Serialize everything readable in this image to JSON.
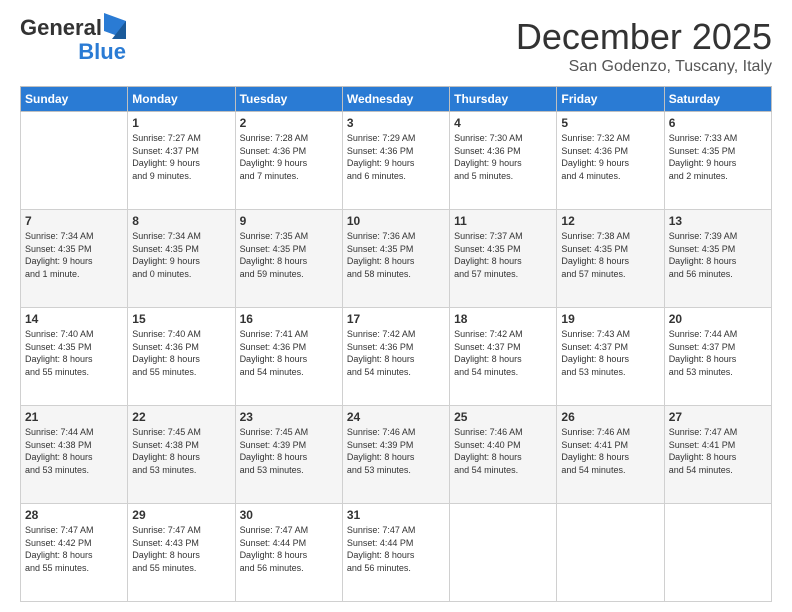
{
  "logo": {
    "general": "General",
    "blue": "Blue"
  },
  "header": {
    "month_title": "December 2025",
    "location": "San Godenzo, Tuscany, Italy"
  },
  "days_of_week": [
    "Sunday",
    "Monday",
    "Tuesday",
    "Wednesday",
    "Thursday",
    "Friday",
    "Saturday"
  ],
  "weeks": [
    [
      {
        "day": "",
        "info": ""
      },
      {
        "day": "1",
        "info": "Sunrise: 7:27 AM\nSunset: 4:37 PM\nDaylight: 9 hours\nand 9 minutes."
      },
      {
        "day": "2",
        "info": "Sunrise: 7:28 AM\nSunset: 4:36 PM\nDaylight: 9 hours\nand 7 minutes."
      },
      {
        "day": "3",
        "info": "Sunrise: 7:29 AM\nSunset: 4:36 PM\nDaylight: 9 hours\nand 6 minutes."
      },
      {
        "day": "4",
        "info": "Sunrise: 7:30 AM\nSunset: 4:36 PM\nDaylight: 9 hours\nand 5 minutes."
      },
      {
        "day": "5",
        "info": "Sunrise: 7:32 AM\nSunset: 4:36 PM\nDaylight: 9 hours\nand 4 minutes."
      },
      {
        "day": "6",
        "info": "Sunrise: 7:33 AM\nSunset: 4:35 PM\nDaylight: 9 hours\nand 2 minutes."
      }
    ],
    [
      {
        "day": "7",
        "info": "Sunrise: 7:34 AM\nSunset: 4:35 PM\nDaylight: 9 hours\nand 1 minute."
      },
      {
        "day": "8",
        "info": "Sunrise: 7:34 AM\nSunset: 4:35 PM\nDaylight: 9 hours\nand 0 minutes."
      },
      {
        "day": "9",
        "info": "Sunrise: 7:35 AM\nSunset: 4:35 PM\nDaylight: 8 hours\nand 59 minutes."
      },
      {
        "day": "10",
        "info": "Sunrise: 7:36 AM\nSunset: 4:35 PM\nDaylight: 8 hours\nand 58 minutes."
      },
      {
        "day": "11",
        "info": "Sunrise: 7:37 AM\nSunset: 4:35 PM\nDaylight: 8 hours\nand 57 minutes."
      },
      {
        "day": "12",
        "info": "Sunrise: 7:38 AM\nSunset: 4:35 PM\nDaylight: 8 hours\nand 57 minutes."
      },
      {
        "day": "13",
        "info": "Sunrise: 7:39 AM\nSunset: 4:35 PM\nDaylight: 8 hours\nand 56 minutes."
      }
    ],
    [
      {
        "day": "14",
        "info": "Sunrise: 7:40 AM\nSunset: 4:35 PM\nDaylight: 8 hours\nand 55 minutes."
      },
      {
        "day": "15",
        "info": "Sunrise: 7:40 AM\nSunset: 4:36 PM\nDaylight: 8 hours\nand 55 minutes."
      },
      {
        "day": "16",
        "info": "Sunrise: 7:41 AM\nSunset: 4:36 PM\nDaylight: 8 hours\nand 54 minutes."
      },
      {
        "day": "17",
        "info": "Sunrise: 7:42 AM\nSunset: 4:36 PM\nDaylight: 8 hours\nand 54 minutes."
      },
      {
        "day": "18",
        "info": "Sunrise: 7:42 AM\nSunset: 4:37 PM\nDaylight: 8 hours\nand 54 minutes."
      },
      {
        "day": "19",
        "info": "Sunrise: 7:43 AM\nSunset: 4:37 PM\nDaylight: 8 hours\nand 53 minutes."
      },
      {
        "day": "20",
        "info": "Sunrise: 7:44 AM\nSunset: 4:37 PM\nDaylight: 8 hours\nand 53 minutes."
      }
    ],
    [
      {
        "day": "21",
        "info": "Sunrise: 7:44 AM\nSunset: 4:38 PM\nDaylight: 8 hours\nand 53 minutes."
      },
      {
        "day": "22",
        "info": "Sunrise: 7:45 AM\nSunset: 4:38 PM\nDaylight: 8 hours\nand 53 minutes."
      },
      {
        "day": "23",
        "info": "Sunrise: 7:45 AM\nSunset: 4:39 PM\nDaylight: 8 hours\nand 53 minutes."
      },
      {
        "day": "24",
        "info": "Sunrise: 7:46 AM\nSunset: 4:39 PM\nDaylight: 8 hours\nand 53 minutes."
      },
      {
        "day": "25",
        "info": "Sunrise: 7:46 AM\nSunset: 4:40 PM\nDaylight: 8 hours\nand 54 minutes."
      },
      {
        "day": "26",
        "info": "Sunrise: 7:46 AM\nSunset: 4:41 PM\nDaylight: 8 hours\nand 54 minutes."
      },
      {
        "day": "27",
        "info": "Sunrise: 7:47 AM\nSunset: 4:41 PM\nDaylight: 8 hours\nand 54 minutes."
      }
    ],
    [
      {
        "day": "28",
        "info": "Sunrise: 7:47 AM\nSunset: 4:42 PM\nDaylight: 8 hours\nand 55 minutes."
      },
      {
        "day": "29",
        "info": "Sunrise: 7:47 AM\nSunset: 4:43 PM\nDaylight: 8 hours\nand 55 minutes."
      },
      {
        "day": "30",
        "info": "Sunrise: 7:47 AM\nSunset: 4:44 PM\nDaylight: 8 hours\nand 56 minutes."
      },
      {
        "day": "31",
        "info": "Sunrise: 7:47 AM\nSunset: 4:44 PM\nDaylight: 8 hours\nand 56 minutes."
      },
      {
        "day": "",
        "info": ""
      },
      {
        "day": "",
        "info": ""
      },
      {
        "day": "",
        "info": ""
      }
    ]
  ]
}
